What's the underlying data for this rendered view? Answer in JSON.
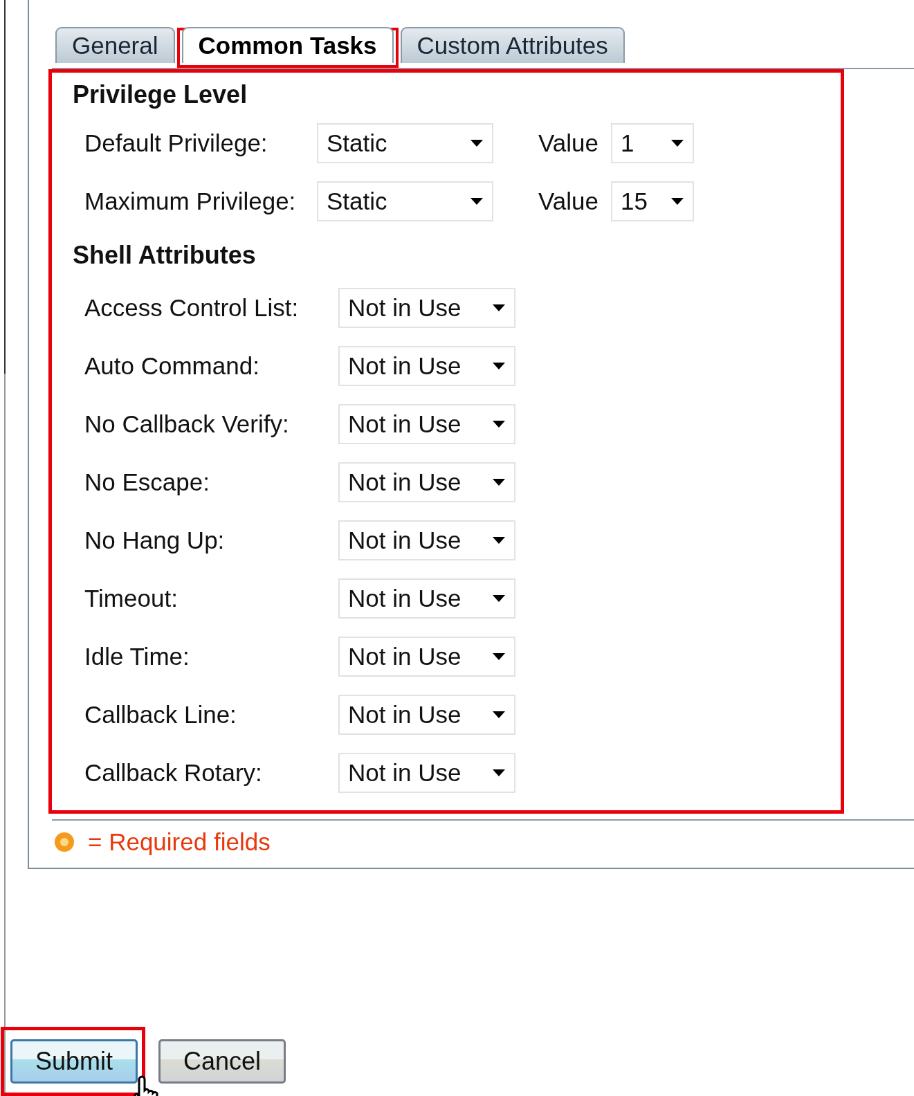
{
  "tabs": [
    {
      "label": "General",
      "selected": false,
      "highlighted": false
    },
    {
      "label": "Common Tasks",
      "selected": true,
      "highlighted": true
    },
    {
      "label": "Custom Attributes",
      "selected": false,
      "highlighted": false
    }
  ],
  "form": {
    "highlighted": true,
    "privilege_level": {
      "heading": "Privilege Level",
      "rows": [
        {
          "label": "Default Privilege:",
          "mode": "Static",
          "value_label": "Value",
          "value": "1"
        },
        {
          "label": "Maximum Privilege:",
          "mode": "Static",
          "value_label": "Value",
          "value": "15"
        }
      ]
    },
    "shell_attributes": {
      "heading": "Shell Attributes",
      "rows": [
        {
          "label": "Access Control List:",
          "value": "Not in Use"
        },
        {
          "label": "Auto Command:",
          "value": "Not in Use"
        },
        {
          "label": "No Callback Verify:",
          "value": "Not in Use"
        },
        {
          "label": "No Escape:",
          "value": "Not in Use"
        },
        {
          "label": "No Hang Up:",
          "value": "Not in Use"
        },
        {
          "label": "Timeout:",
          "value": "Not in Use"
        },
        {
          "label": "Idle Time:",
          "value": "Not in Use"
        },
        {
          "label": "Callback Line:",
          "value": "Not in Use"
        },
        {
          "label": "Callback Rotary:",
          "value": "Not in Use"
        }
      ]
    }
  },
  "required_note": "= Required fields",
  "buttons": [
    {
      "label": "Submit",
      "kind": "primary",
      "highlighted": true
    },
    {
      "label": "Cancel",
      "kind": "secondary",
      "highlighted": false
    }
  ]
}
